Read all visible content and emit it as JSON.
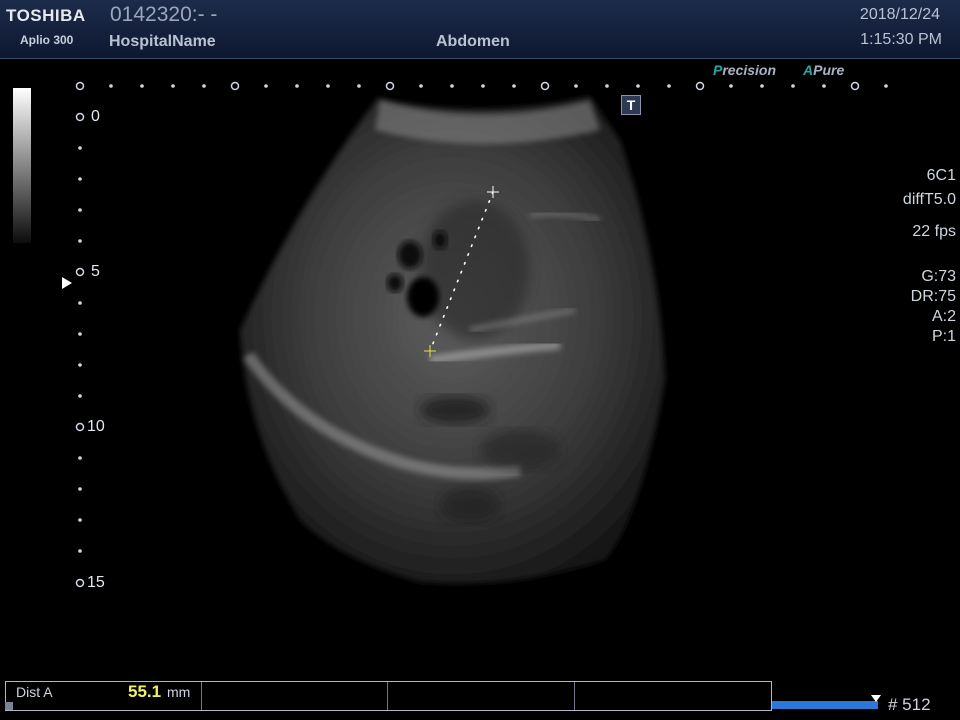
{
  "header": {
    "brand": "TOSHIBA",
    "model": "Aplio 300",
    "patient_id": "0142320:- -",
    "hospital": "HospitalName",
    "exam": "Abdomen",
    "date": "2018/12/24",
    "time": "1:15:30 PM"
  },
  "brandline": {
    "precision_letter": "P",
    "precision_rest": "recision",
    "apure_letter": "A",
    "apure_rest": "Pure"
  },
  "tool_icon_letter": "T",
  "params": {
    "probe": "6C1",
    "mode": "diffT5.0",
    "fps": "22 fps",
    "gain": "G:73",
    "dynamic_range": "DR:75",
    "a": "A:2",
    "p": "P:1"
  },
  "depth_scale": [
    "0",
    "5",
    "10",
    "15"
  ],
  "measurement": {
    "label": "Dist A",
    "value": "55.1",
    "unit": "mm"
  },
  "frame": {
    "number": "# 512"
  }
}
